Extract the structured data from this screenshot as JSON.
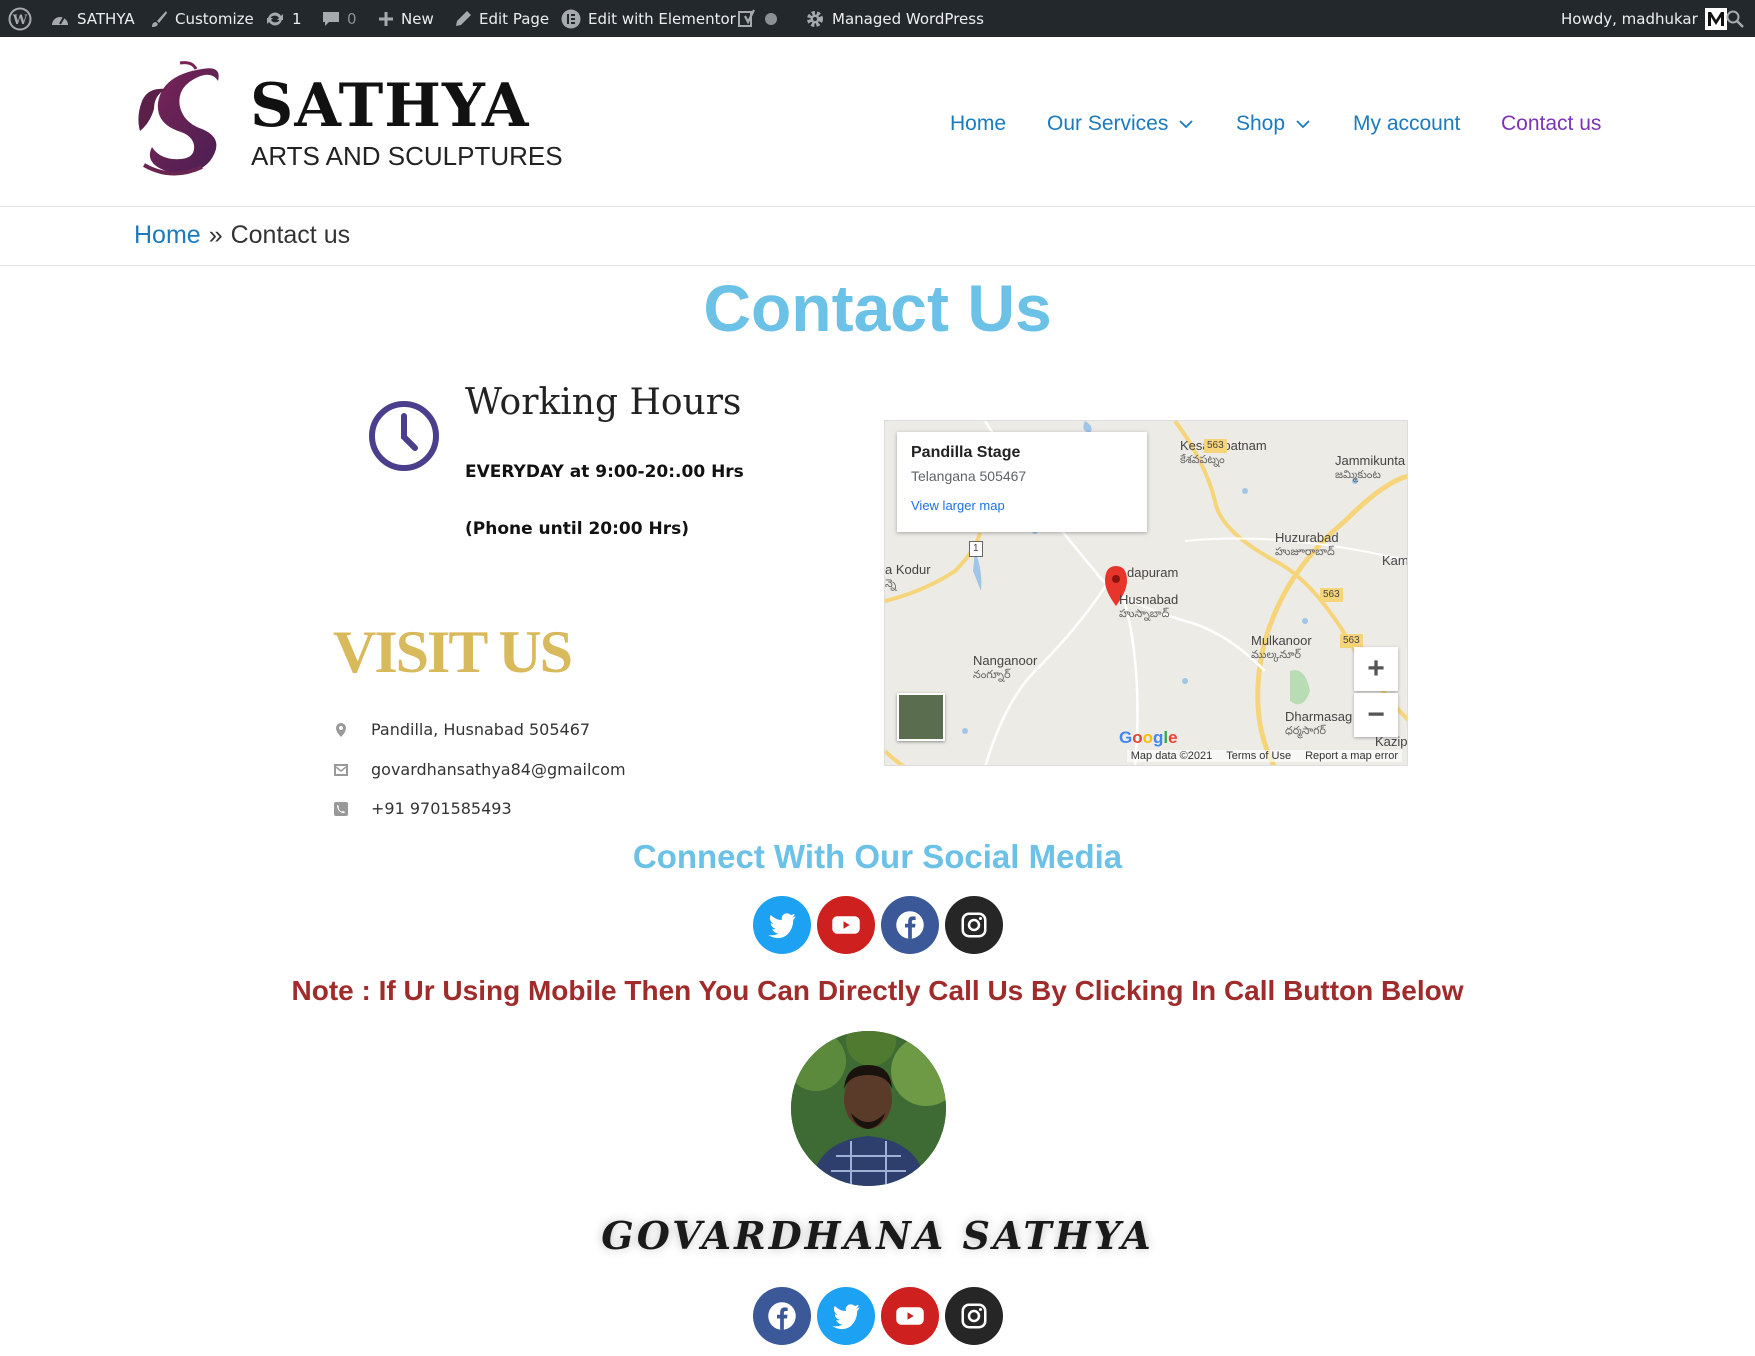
{
  "admin_bar": {
    "site": "SATHYA",
    "customize": "Customize",
    "updates": "1",
    "comments": "0",
    "new": "New",
    "edit_page": "Edit Page",
    "edit_elementor": "Edit with Elementor",
    "managed": "Managed WordPress",
    "howdy": "Howdy, madhukar"
  },
  "header": {
    "title": "SATHYA",
    "tagline": "ARTS AND SCULPTURES",
    "nav": [
      "Home",
      "Our Services",
      "Shop",
      "My account",
      "Contact us"
    ]
  },
  "breadcrumb": {
    "home": "Home",
    "sep": "»",
    "current": "Contact us"
  },
  "page_heading": "Contact Us",
  "working_hours": {
    "title": "Working Hours",
    "line1": "EVERYDAY at 9:00-20:.00 Hrs",
    "line2": "(Phone until 20:00 Hrs)"
  },
  "visit": {
    "title": "VISIT US",
    "address": "Pandilla, Husnabad 505467",
    "email": "govardhansathya84@gmailcom",
    "phone": "+91 9701585493"
  },
  "map": {
    "place": "Pandilla Stage",
    "address": "Telangana 505467",
    "link": "View larger map",
    "google": "Google",
    "footer": [
      "Map data ©2021",
      "Terms of Use",
      "Report a map error"
    ],
    "labels": [
      {
        "en": "Kesavapatnam",
        "te": "కేశవపట్నం"
      },
      {
        "en": "Jammikunta",
        "te": "జమ్మికుంట"
      },
      {
        "en": "Huzurabad",
        "te": "హుజూరాబాద్"
      },
      {
        "en": "a Kodur",
        "te": "న్నె"
      },
      {
        "en": "dapuram",
        "te": ""
      },
      {
        "en": "Husnabad",
        "te": "హుస్నాబాద్"
      },
      {
        "en": "Mulkanoor",
        "te": "ముల్కనూర్"
      },
      {
        "en": "Nanganoor",
        "te": "నంగ్నూర్"
      },
      {
        "en": "Dharmasag",
        "te": "ధర్మసాగర్"
      },
      {
        "en": "Kam",
        "te": ""
      },
      {
        "en": "Kazip",
        "te": ""
      }
    ],
    "road_labels": [
      "563",
      "563",
      "563",
      "1"
    ]
  },
  "social_heading": "Connect With Our Social Media",
  "note": "Note : If Ur Using Mobile Then You Can Directly Call Us By Clicking In Call Button Below",
  "person_name": "GOVARDHANA SATHYA",
  "colors": {
    "accent": "#6cc1e6",
    "link": "#1b7bbe",
    "gold": "#d8b95c",
    "note": "#a02b2b",
    "clock": "#4a3f8c"
  }
}
